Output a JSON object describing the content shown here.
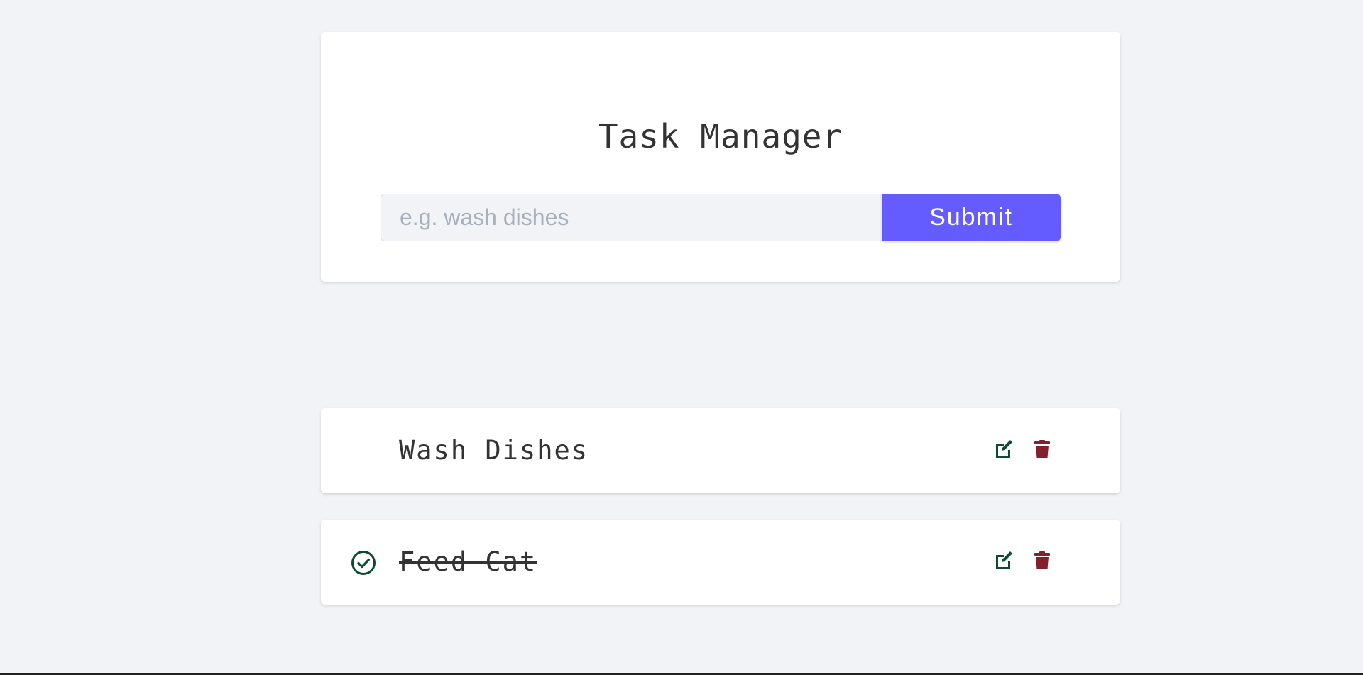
{
  "app": {
    "title": "Task Manager"
  },
  "form": {
    "input_value": "",
    "input_placeholder": "e.g. wash dishes",
    "submit_label": "Submit"
  },
  "tasks": [
    {
      "name": "Wash Dishes",
      "completed": false
    },
    {
      "name": "Feed Cat",
      "completed": true
    }
  ],
  "icons": {
    "edit": "edit-icon",
    "delete": "trash-icon",
    "completed": "check-circle-icon"
  },
  "colors": {
    "background": "#f1f3f7",
    "card": "#ffffff",
    "accent": "#645cff",
    "edit": "#0b4d2c",
    "delete": "#842029",
    "check": "#0b4d2c",
    "text": "#333333"
  }
}
